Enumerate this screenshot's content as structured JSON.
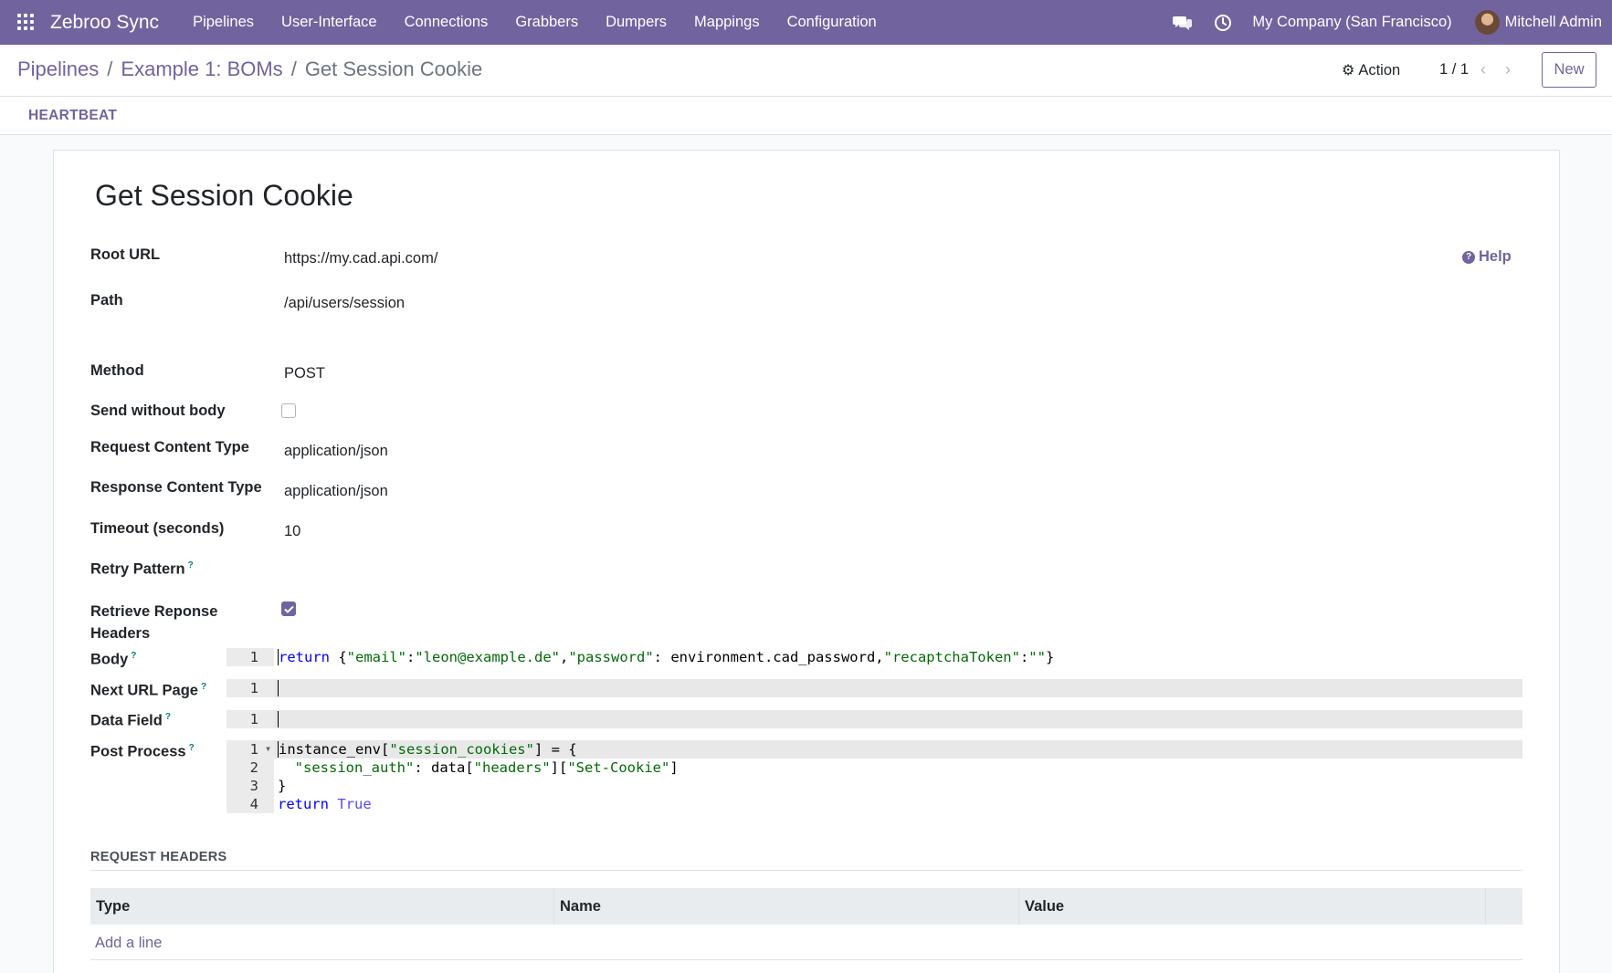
{
  "navbar": {
    "brand": "Zebroo Sync",
    "menu": [
      "Pipelines",
      "User-Interface",
      "Connections",
      "Grabbers",
      "Dumpers",
      "Mappings",
      "Configuration"
    ],
    "company": "My Company (San Francisco)",
    "user": "Mitchell Admin",
    "icons": [
      "apps-grid-icon",
      "chat-icon",
      "clock-icon"
    ],
    "accent_color": "#71639e"
  },
  "breadcrumb": {
    "items": [
      "Pipelines",
      "Example 1: BOMs"
    ],
    "separator": "/",
    "current": "Get Session Cookie"
  },
  "control": {
    "action_label": "Action",
    "pager": "1 / 1",
    "new_label": "New"
  },
  "statusbar": {
    "button": "HEARTBEAT"
  },
  "form": {
    "title": "Get Session Cookie",
    "help_label": "Help",
    "fields": {
      "root_url": {
        "label": "Root URL",
        "value": "https://my.cad.api.com/"
      },
      "path": {
        "label": "Path",
        "value": "/api/users/session"
      },
      "method": {
        "label": "Method",
        "value": "POST"
      },
      "send_without_body": {
        "label": "Send without body",
        "checked": false
      },
      "request_content_type": {
        "label": "Request Content Type",
        "value": "application/json"
      },
      "response_content_type": {
        "label": "Response Content Type",
        "value": "application/json"
      },
      "timeout": {
        "label": "Timeout (seconds)",
        "value": "10"
      },
      "retry_pattern": {
        "label": "Retry Pattern",
        "help": "?"
      },
      "retrieve_headers": {
        "label_line1": "Retrieve Reponse",
        "label_line2": "Headers",
        "checked": true
      },
      "body": {
        "label": "Body",
        "help": "?"
      },
      "next_url_page": {
        "label": "Next URL Page",
        "help": "?"
      },
      "data_field": {
        "label": "Data Field",
        "help": "?"
      },
      "post_process": {
        "label": "Post Process",
        "help": "?"
      }
    },
    "editors": {
      "body": {
        "line_numbers": [
          "1"
        ]
      },
      "next_url_page": {
        "line_numbers": [
          "1"
        ]
      },
      "data_field": {
        "line_numbers": [
          "1"
        ]
      },
      "post_process": {
        "line_numbers": [
          "1",
          "2",
          "3",
          "4"
        ]
      }
    }
  },
  "request_headers": {
    "title": "REQUEST HEADERS",
    "columns": [
      "Type",
      "Name",
      "Value"
    ],
    "add_line": "Add a line"
  }
}
